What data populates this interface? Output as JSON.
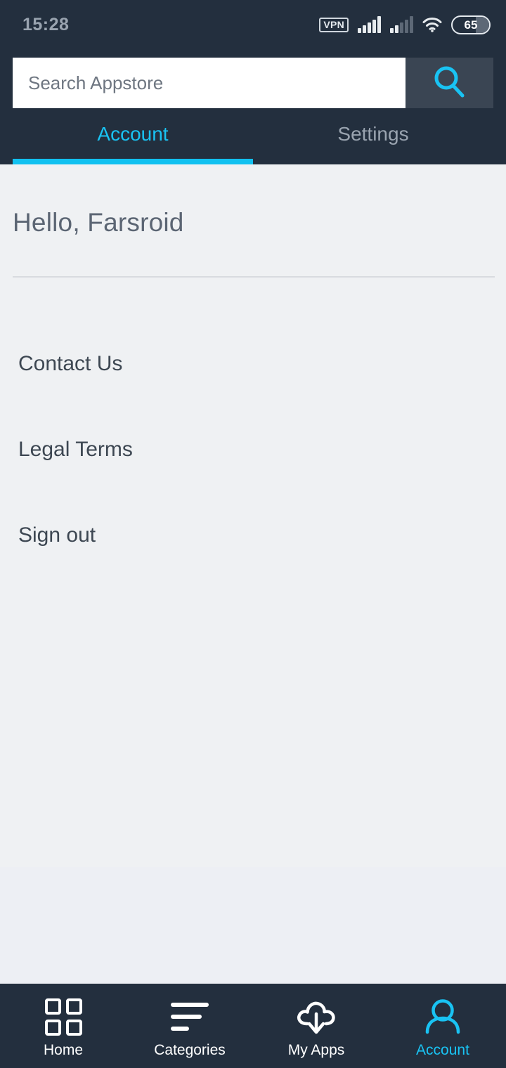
{
  "statusbar": {
    "time": "15:28",
    "vpn_label": "VPN",
    "battery_level": "65",
    "icons": [
      "vpn-icon",
      "signal-icon",
      "signal-icon-secondary",
      "wifi-icon",
      "battery-icon"
    ]
  },
  "search": {
    "placeholder": "Search Appstore",
    "value": "",
    "button_icon": "search-icon"
  },
  "tabs": [
    {
      "label": "Account",
      "active": true
    },
    {
      "label": "Settings",
      "active": false
    }
  ],
  "main": {
    "greeting": "Hello, Farsroid",
    "menu": [
      {
        "label": "Contact Us"
      },
      {
        "label": "Legal Terms"
      },
      {
        "label": "Sign out"
      }
    ]
  },
  "bottom_nav": [
    {
      "label": "Home",
      "icon": "grid-icon",
      "active": false
    },
    {
      "label": "Categories",
      "icon": "lines-icon",
      "active": false
    },
    {
      "label": "My Apps",
      "icon": "cloud-download-icon",
      "active": false
    },
    {
      "label": "Account",
      "icon": "person-icon",
      "active": true
    }
  ],
  "colors": {
    "header_bg": "#232f3e",
    "accent": "#19c3f3",
    "indicator": "#11c1f0",
    "content_bg": "#eff1f3",
    "search_button_bg": "#3a4553",
    "text_primary": "#3d4752",
    "text_muted": "#9aa4b0"
  }
}
